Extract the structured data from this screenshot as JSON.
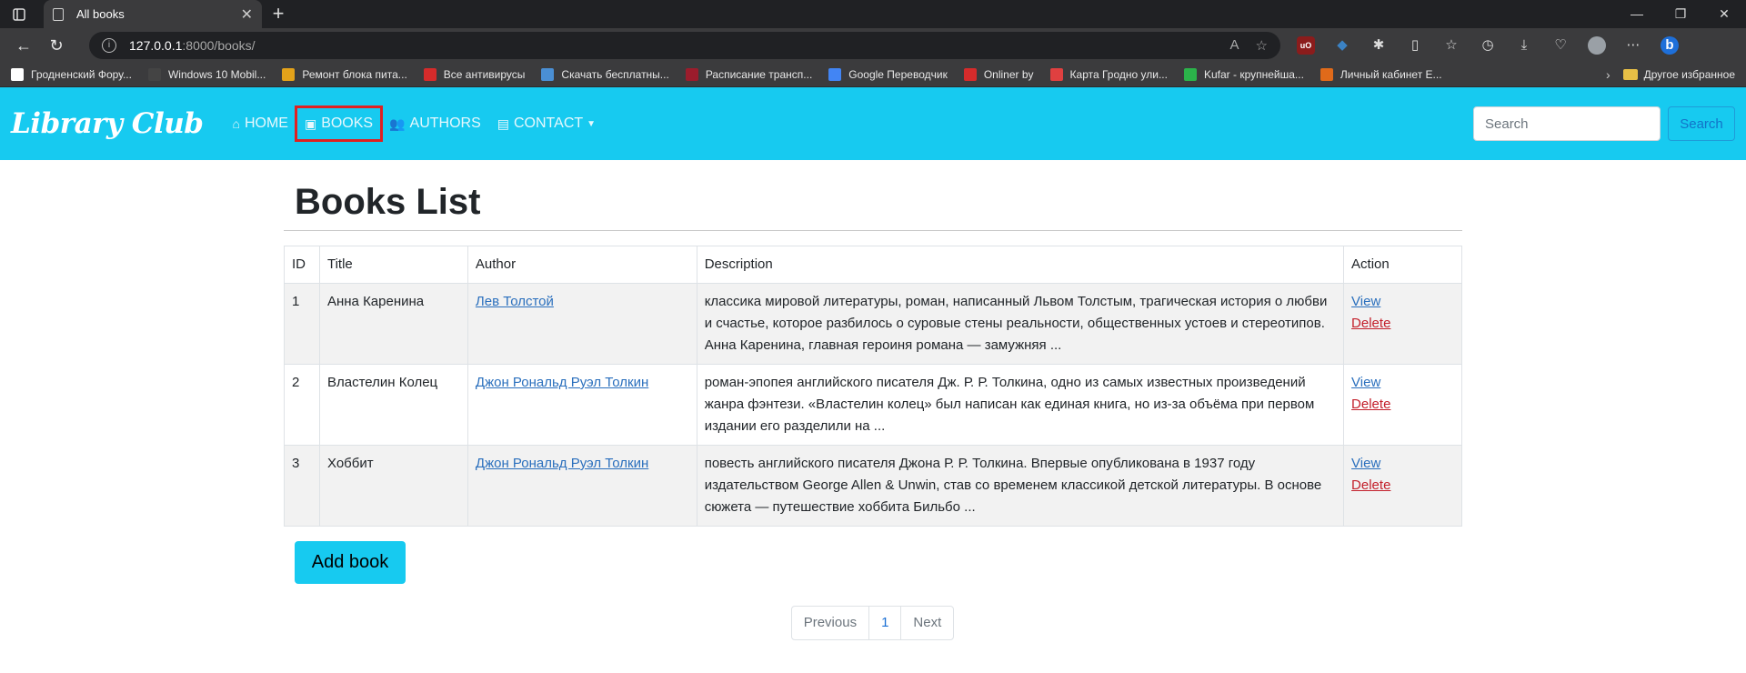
{
  "browser": {
    "tab_title": "All books",
    "url_host": "127.0.0.1",
    "url_path": ":8000/books/",
    "bookmarks": [
      {
        "label": "Гродненский Фору...",
        "color": "#ffffff"
      },
      {
        "label": "Windows 10 Mobil...",
        "color": "#444444"
      },
      {
        "label": "Ремонт блока пита...",
        "color": "#e3a21a"
      },
      {
        "label": "Все антивирусы",
        "color": "#d62b2b"
      },
      {
        "label": "Скачать бесплатны...",
        "color": "#4a8fd4"
      },
      {
        "label": "Расписание трансп...",
        "color": "#9b1c2c"
      },
      {
        "label": "Google Переводчик",
        "color": "#4285f4"
      },
      {
        "label": "Onliner by",
        "color": "#d62b2b"
      },
      {
        "label": "Карта Гродно  ули...",
        "color": "#e04040"
      },
      {
        "label": "Kufar - крупнейша...",
        "color": "#2bb34a"
      },
      {
        "label": "Личный кабинет E...",
        "color": "#e06a1a"
      }
    ],
    "other_bookmarks": "Другое избранное"
  },
  "navbar": {
    "brand": "Library Club",
    "items": [
      {
        "label": "HOME",
        "icon": "home-icon"
      },
      {
        "label": "BOOKS",
        "icon": "book-icon"
      },
      {
        "label": "AUTHORS",
        "icon": "users-icon"
      },
      {
        "label": "CONTACT",
        "icon": "contact-icon"
      }
    ],
    "search_placeholder": "Search",
    "search_button": "Search"
  },
  "main": {
    "title": "Books List",
    "columns": [
      "ID",
      "Title",
      "Author",
      "Description",
      "Action"
    ],
    "rows": [
      {
        "id": "1",
        "title": "Анна Каренина",
        "author": "Лев Толстой",
        "description": "классика мировой литературы, роман, написанный Львом Толстым, трагическая история о любви и счастье, которое разбилось о суровые стены реальности, общественных устоев и стереотипов. Анна Каренина, главная героиня романа — замужняя ...",
        "view": "View",
        "delete": "Delete"
      },
      {
        "id": "2",
        "title": "Властелин Колец",
        "author": "Джон Рональд Руэл Толкин",
        "description": "роман-эпопея английского писателя Дж. Р. Р. Толкина, одно из самых известных произведений жанра фэнтези. «Властелин колец» был написан как единая книга, но из-за объёма при первом издании его разделили на ...",
        "view": "View",
        "delete": "Delete"
      },
      {
        "id": "3",
        "title": "Хоббит",
        "author": "Джон Рональд Руэл Толкин",
        "description": "повесть английского писателя Джона Р. Р. Толкина. Впервые опубликована в 1937 году издательством George Allen & Unwin, став со временем классикой детской литературы. В основе сюжета — путешествие хоббита Бильбо ...",
        "view": "View",
        "delete": "Delete"
      }
    ],
    "add_button": "Add book",
    "pagination": {
      "previous": "Previous",
      "current": "1",
      "next": "Next"
    }
  }
}
